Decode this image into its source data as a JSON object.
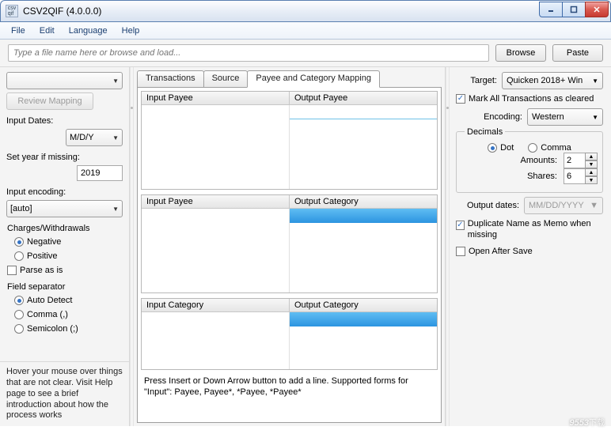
{
  "window": {
    "title": "CSV2QIF (4.0.0.0)"
  },
  "menu": {
    "file": "File",
    "edit": "Edit",
    "language": "Language",
    "help": "Help"
  },
  "toolbar": {
    "placeholder": "Type a file name here or browse and load...",
    "browse": "Browse",
    "paste": "Paste"
  },
  "left": {
    "review": "Review Mapping",
    "input_dates_lbl": "Input Dates:",
    "input_dates_val": "M/D/Y",
    "set_year_lbl": "Set year if missing:",
    "set_year_val": "2019",
    "input_enc_lbl": "Input encoding:",
    "input_enc_val": "[auto]",
    "charges_lbl": "Charges/Withdrawals",
    "negative": "Negative",
    "positive": "Positive",
    "parse_as_is": "Parse as is",
    "field_sep_lbl": "Field separator",
    "auto_detect": "Auto Detect",
    "comma": "Comma (,)",
    "semicolon": "Semicolon (;)",
    "hint": "Hover your mouse over things that are not clear. Visit Help page to see a brief introduction about how the process works"
  },
  "tabs": {
    "t1": "Transactions",
    "t2": "Source",
    "t3": "Payee and Category Mapping"
  },
  "maps": {
    "h_input_payee": "Input Payee",
    "h_output_payee": "Output Payee",
    "h_output_category": "Output Category",
    "h_input_category": "Input Category",
    "footnote": "Press Insert or Down Arrow button to add a line. Supported forms for \"Input\": Payee, Payee*, *Payee, *Payee*"
  },
  "right": {
    "target_lbl": "Target:",
    "target_val": "Quicken 2018+ Win",
    "mark_cleared": "Mark All Transactions as cleared",
    "encoding_lbl": "Encoding:",
    "encoding_val": "Western",
    "decimals_lbl": "Decimals",
    "dot": "Dot",
    "comma": "Comma",
    "amounts_lbl": "Amounts:",
    "amounts_val": "2",
    "shares_lbl": "Shares:",
    "shares_val": "6",
    "outdates_lbl": "Output dates:",
    "outdates_val": "MM/DD/YYYY",
    "dup_name": "Duplicate Name as Memo when missing",
    "open_after": "Open After Save"
  },
  "watermark": {
    "main": "9553",
    "sub": "下载"
  }
}
